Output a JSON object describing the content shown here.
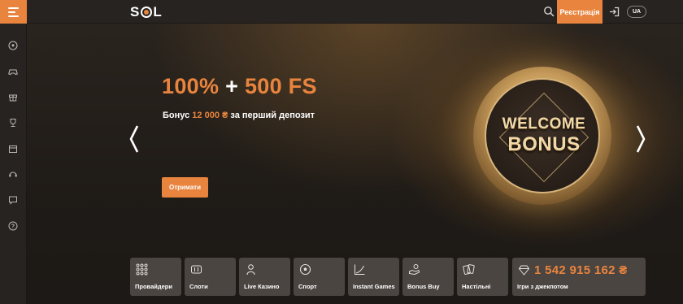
{
  "header": {
    "logo_left": "S",
    "logo_right": "L",
    "register_label": "Реєстрація",
    "lang_label": "UA"
  },
  "sidebar": {
    "items": [
      {
        "icon": "soccer-ball-icon"
      },
      {
        "icon": "gamepad-icon"
      },
      {
        "icon": "gift-icon"
      },
      {
        "icon": "trophy-icon"
      },
      {
        "icon": "calendar-icon"
      },
      {
        "icon": "support-icon"
      },
      {
        "icon": "chat-icon"
      },
      {
        "icon": "help-icon"
      }
    ]
  },
  "hero": {
    "title_pct": "100%",
    "title_plus": " + ",
    "title_fs": "500 FS",
    "subtitle_prefix": "Бонус ",
    "subtitle_amount": "12 000 ₴",
    "subtitle_suffix": " за перший депозит",
    "button_label": "Отримати",
    "coin_line1": "WELCOME",
    "coin_line2": "BONUS"
  },
  "categories": [
    {
      "label": "Провайдери",
      "icon": "grid-dots-icon"
    },
    {
      "label": "Слоти",
      "icon": "slot-machine-icon"
    },
    {
      "label": "Live Казино",
      "icon": "dealer-icon"
    },
    {
      "label": "Спорт",
      "icon": "soccer-ball-icon"
    },
    {
      "label": "Instant Games",
      "icon": "chart-line-icon"
    },
    {
      "label": "Bonus Buy",
      "icon": "hand-coin-icon"
    },
    {
      "label": "Настільні",
      "icon": "cards-icon"
    }
  ],
  "jackpot": {
    "amount": "1 542 915 162 ₴",
    "label": "Ігри з джекпотом",
    "icon": "diamond-icon"
  },
  "colors": {
    "accent": "#e8843e",
    "topbar": "#262321",
    "tile": "#4b4541"
  }
}
